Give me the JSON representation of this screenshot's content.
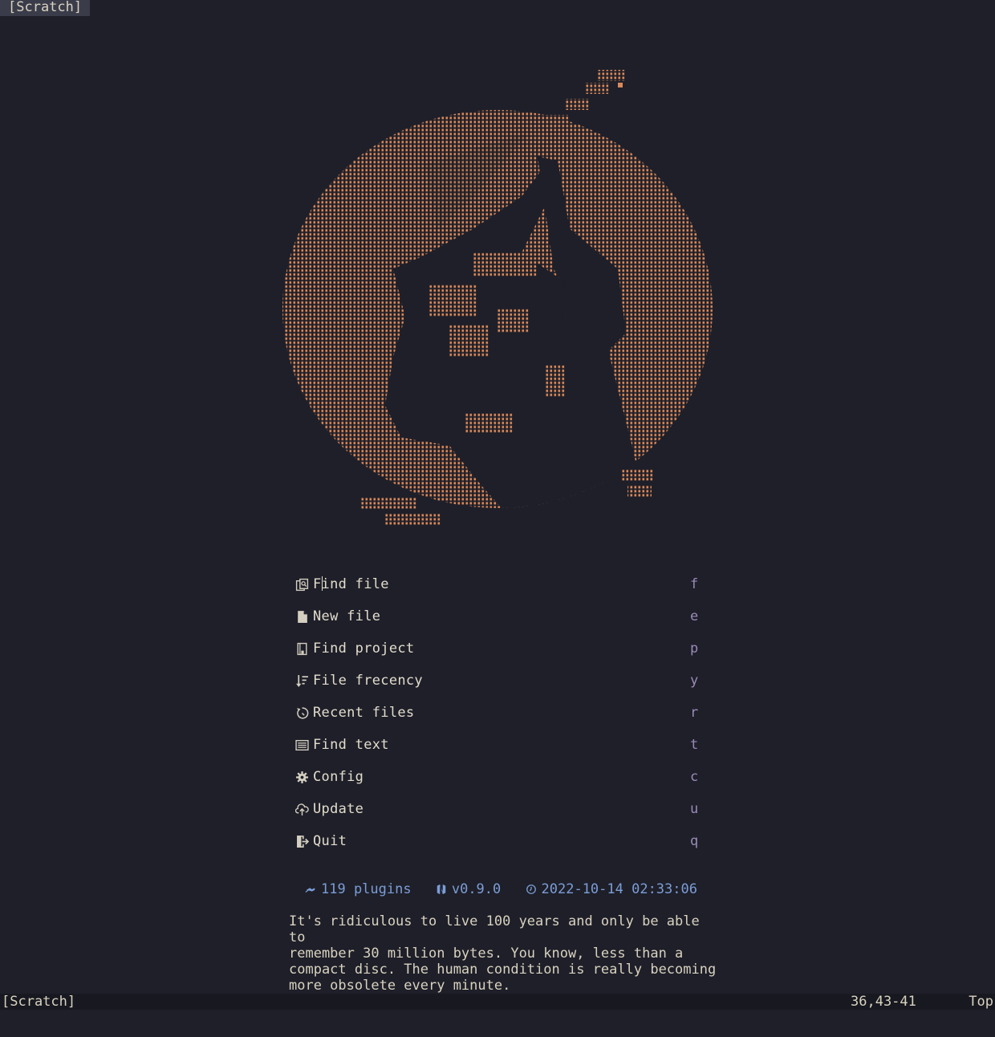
{
  "tabline": {
    "active_tab": "[Scratch]"
  },
  "header_art": {
    "icon": "braille-art-figure-circle",
    "color": "#d9895a"
  },
  "menu": {
    "items": [
      {
        "label": "Find file",
        "key": "f",
        "icon": "find-file-icon"
      },
      {
        "label": "New file",
        "key": "e",
        "icon": "new-file-icon"
      },
      {
        "label": "Find project",
        "key": "p",
        "icon": "project-icon"
      },
      {
        "label": "File frecency",
        "key": "y",
        "icon": "sort-icon"
      },
      {
        "label": "Recent files",
        "key": "r",
        "icon": "history-icon"
      },
      {
        "label": "Find text",
        "key": "t",
        "icon": "text-search-icon"
      },
      {
        "label": "Config",
        "key": "c",
        "icon": "gear-icon"
      },
      {
        "label": "Update",
        "key": "u",
        "icon": "cloud-upload-icon"
      },
      {
        "label": "Quit",
        "key": "q",
        "icon": "exit-icon"
      }
    ]
  },
  "footer": {
    "plugins": "119 plugins",
    "version": "v0.9.0",
    "datetime": "2022-10-14 02:33:06"
  },
  "quote": "It's ridiculous to live 100 years and only be able to\nremember 30 million bytes. You know, less than a\ncompact disc. The human condition is really becoming\nmore obsolete every minute.",
  "statusline": {
    "filename": "[Scratch]",
    "position": "36,43-41",
    "scroll": "Top"
  },
  "colors": {
    "background": "#1e1f29",
    "art": "#d9895a",
    "key": "#9b8ab8",
    "footer": "#7c9dd6",
    "text": "#d9d2bf"
  }
}
